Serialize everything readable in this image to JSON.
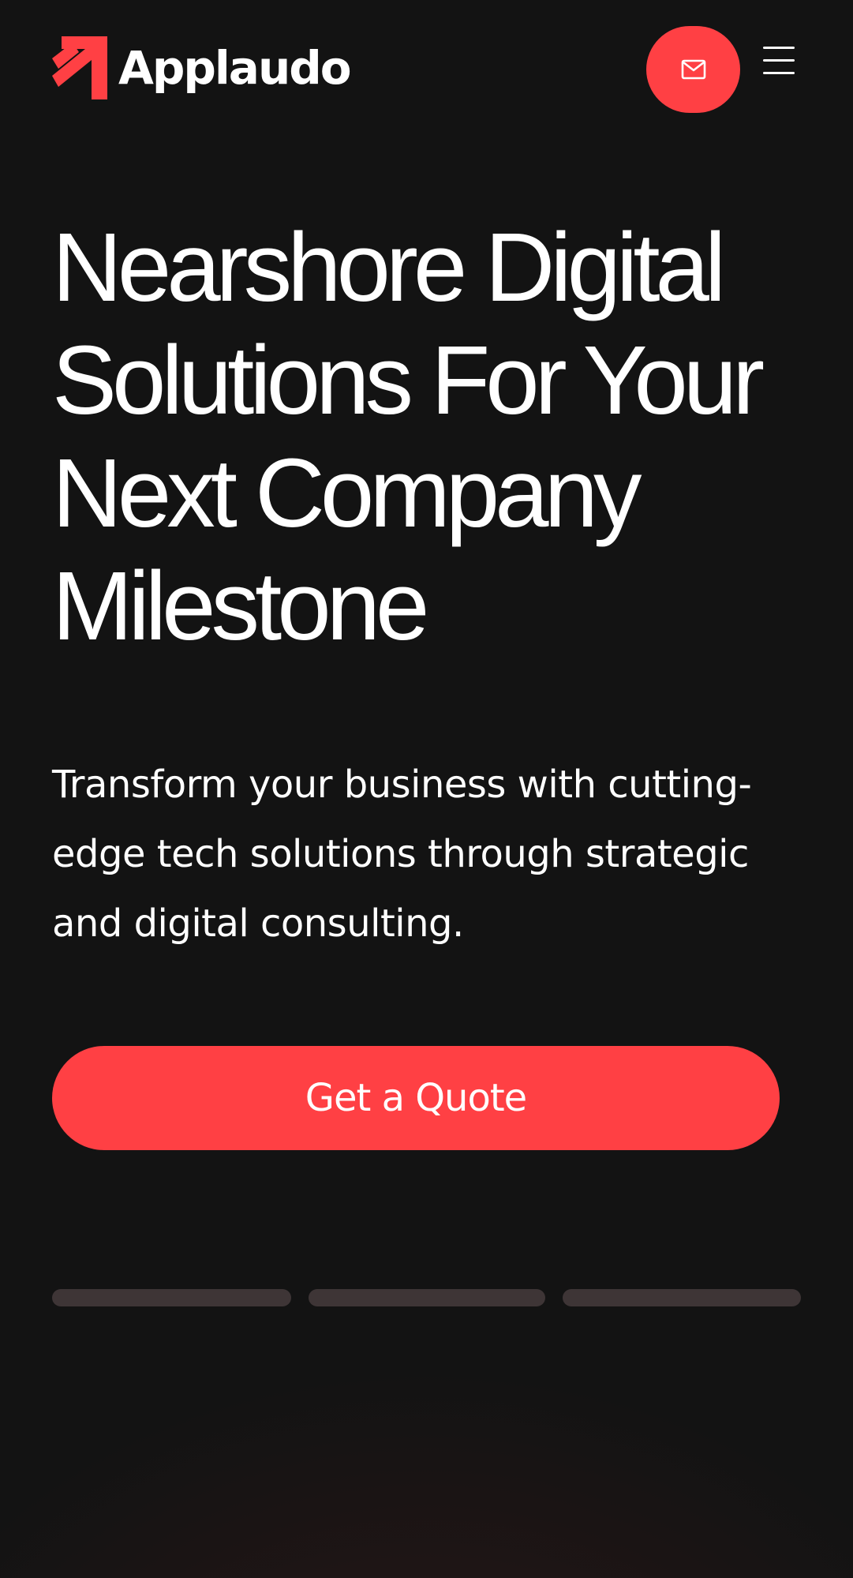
{
  "header": {
    "brand_name": "Applaudo",
    "logo_icon": "applaudo-arrow-logo",
    "mail_icon": "envelope-icon",
    "menu_icon": "hamburger-menu-icon"
  },
  "hero": {
    "title_lines": [
      "Nearshore Digital",
      "Solutions For Your",
      "Next Company",
      "Milestone"
    ],
    "subtitle": "Transform your business with cutting-edge tech solutions through strategic and digital consulting.",
    "cta_label": "Get a Quote"
  },
  "slider": {
    "slide_count": 3
  },
  "colors": {
    "accent": "#ff4044",
    "background": "#131313",
    "background_warm": "#2d1818",
    "text": "#ffffff",
    "slider_dot": "#3e3536"
  }
}
